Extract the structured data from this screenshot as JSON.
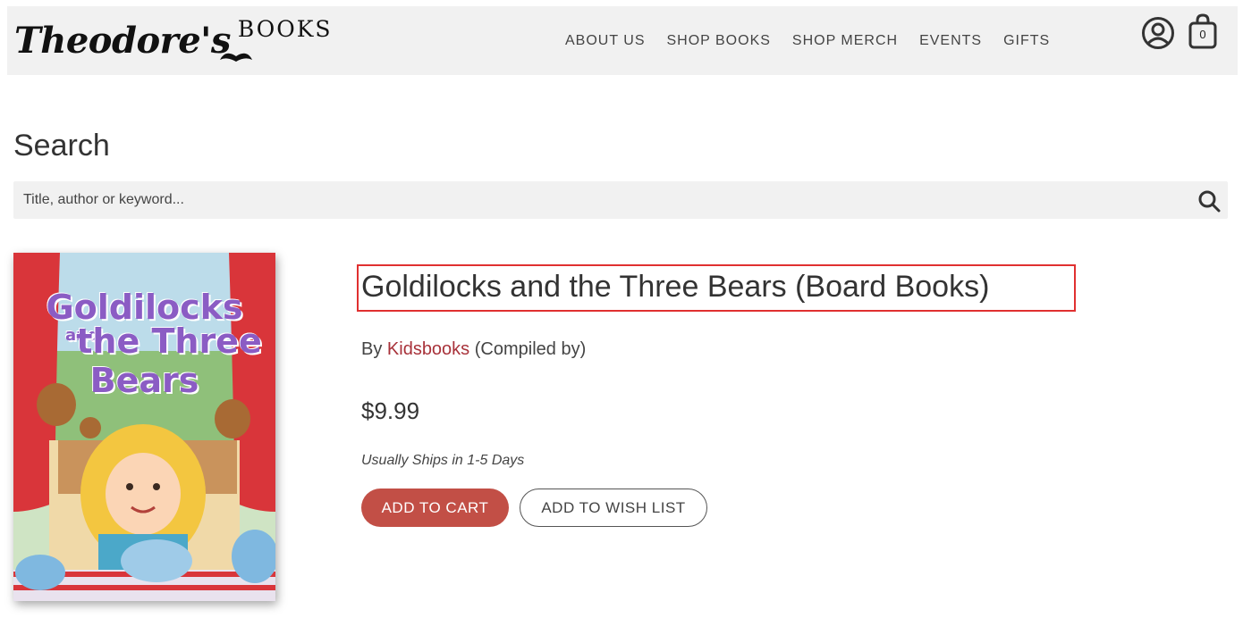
{
  "header": {
    "logo_text": "Theodore's",
    "logo_sub": "BOOKS",
    "nav": [
      {
        "label": "ABOUT US"
      },
      {
        "label": "SHOP BOOKS"
      },
      {
        "label": "SHOP MERCH"
      },
      {
        "label": "EVENTS"
      },
      {
        "label": "GIFTS"
      }
    ],
    "cart_count": "0",
    "icons": {
      "account": "account-circle-icon",
      "cart": "shopping-bag-icon"
    }
  },
  "search": {
    "title": "Search",
    "placeholder": "Title, author or keyword...",
    "icon": "search-icon"
  },
  "product": {
    "cover_title_lines": [
      "Goldilocks",
      "and",
      "the Three",
      "Bears"
    ],
    "title": "Goldilocks and the Three Bears (Board Books)",
    "by_prefix": "By",
    "author": "Kidsbooks",
    "author_role": "(Compiled by)",
    "price": "$9.99",
    "availability": "Usually Ships in 1-5 Days",
    "add_to_cart_label": "ADD TO CART",
    "add_to_wishlist_label": "ADD TO WISH LIST"
  },
  "colors": {
    "header_bg": "#f1f1f1",
    "accent": "#c24f46",
    "author_link": "#a8323a",
    "highlight_border": "#e03030"
  }
}
